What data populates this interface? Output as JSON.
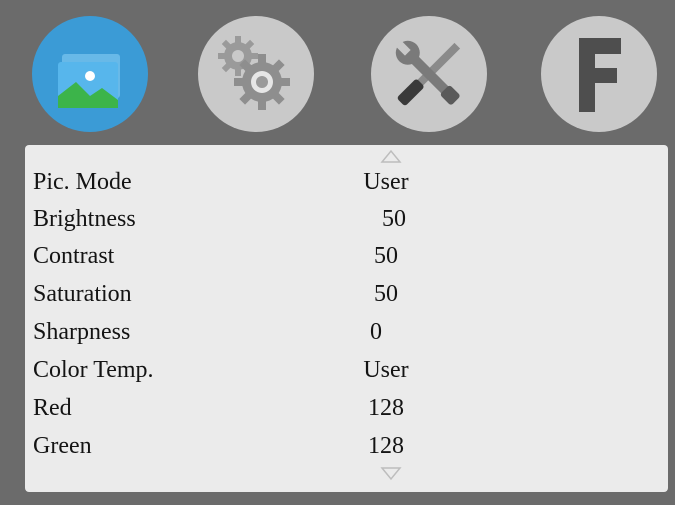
{
  "tabs": [
    {
      "name": "picture",
      "icon": "picture-icon",
      "active": true
    },
    {
      "name": "settings",
      "icon": "gears-icon",
      "active": false
    },
    {
      "name": "tools",
      "icon": "tools-icon",
      "active": false
    },
    {
      "name": "factory",
      "icon": "factory-f-icon",
      "active": false,
      "glyph": "F"
    }
  ],
  "menu": {
    "scroll_up_icon": "triangle-up-icon",
    "scroll_down_icon": "triangle-down-icon",
    "items": [
      {
        "label": "Pic. Mode",
        "value": "User"
      },
      {
        "label": "Brightness",
        "value": "50"
      },
      {
        "label": "Contrast",
        "value": "50"
      },
      {
        "label": "Saturation",
        "value": "50"
      },
      {
        "label": "Sharpness",
        "value": "0"
      },
      {
        "label": "Color Temp.",
        "value": "User"
      },
      {
        "label": "Red",
        "value": "128"
      },
      {
        "label": "Green",
        "value": "128"
      }
    ]
  },
  "colors": {
    "background": "#6b6b6b",
    "panel": "#ebebeb",
    "active_tab": "#3b9bd6",
    "inactive_tab": "#c9c9c9",
    "text": "#141414"
  }
}
